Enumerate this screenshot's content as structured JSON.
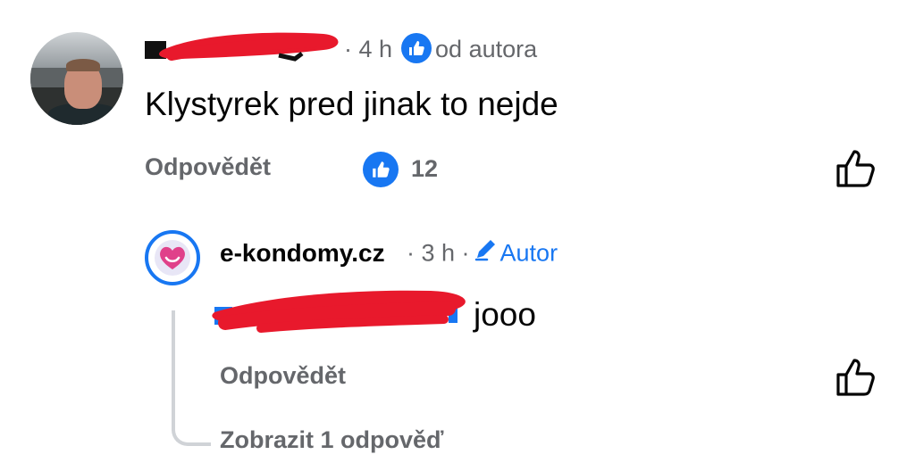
{
  "colors": {
    "accent": "#1877f2",
    "meta_text": "#65676b",
    "body_text": "#050505",
    "redaction": "#e8192c",
    "thread_line": "#d0d3d7"
  },
  "comment": {
    "avatar_icon": "user-photo",
    "time": "· 4 h",
    "author_badge_icon": "thumb-up-icon",
    "author_badge_text": "od autora",
    "text": "Klystyrek pred jinak to nejde",
    "reply_label": "Odpovědět",
    "reaction_icon": "thumb-up-icon",
    "reaction_count": "12",
    "like_icon": "like-outline-icon"
  },
  "reply": {
    "avatar_icon": "heart-smile-logo",
    "author": "e-kondomy.cz",
    "time": "· 3 h ·",
    "author_tag": "Autor",
    "text": "jooo",
    "reply_label": "Odpovědět",
    "like_icon": "like-outline-icon",
    "show_replies": "Zobrazit 1 odpověď"
  }
}
